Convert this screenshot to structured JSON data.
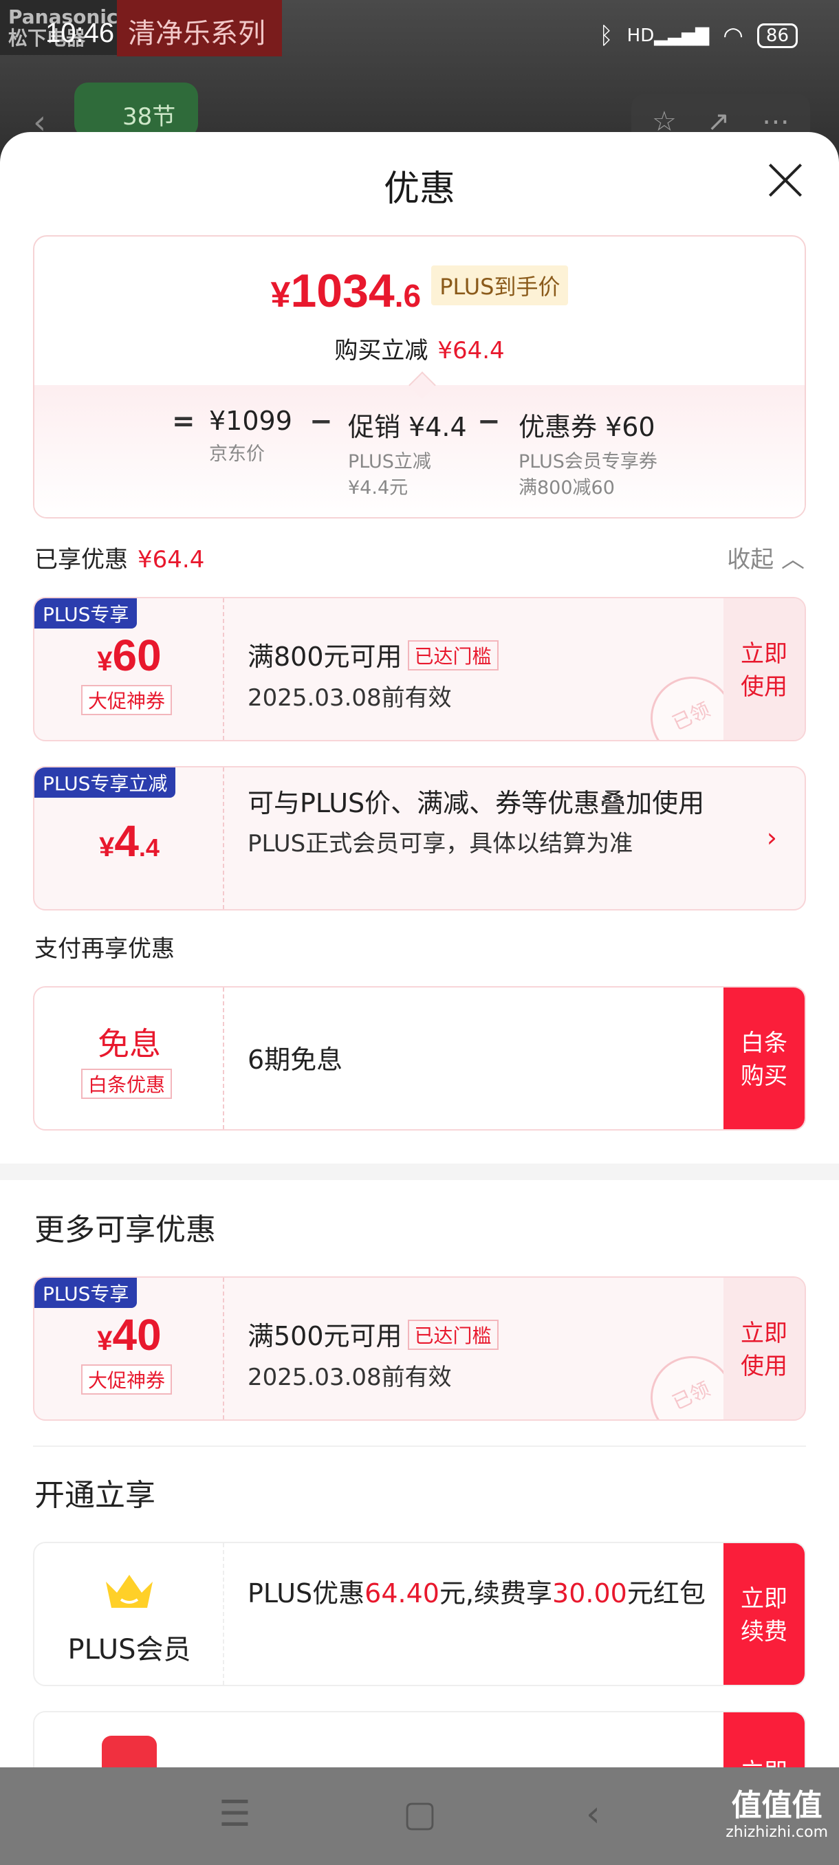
{
  "status": {
    "time": "10:46",
    "battery": "86",
    "net": "HD"
  },
  "background": {
    "brand": "Panasonic 松下电器",
    "series": "清净乐系列",
    "festival": "38节"
  },
  "sheet": {
    "title": "优惠"
  },
  "summary": {
    "price_yen": "¥",
    "price_int": "1034",
    "price_dec": ".6",
    "plus_tag": "PLUS到手价",
    "discount_label": "购买立减",
    "discount_value": "¥64.4",
    "eq": "=",
    "minus": "−",
    "jd_price": "¥1099",
    "jd_label": "京东价",
    "promo_value": "促销 ¥4.4",
    "promo_sub1": "PLUS立减",
    "promo_sub2": "¥4.4元",
    "coupon_value": "优惠券 ¥60",
    "coupon_sub1": "PLUS会员专享券",
    "coupon_sub2": "满800减60"
  },
  "enjoyed": {
    "label": "已享优惠",
    "value": "¥64.4",
    "collapse": "收起 ︿"
  },
  "coupon1": {
    "tag": "PLUS专享",
    "yen": "¥",
    "amount": "60",
    "sublabel": "大促神券",
    "line1": "满800元可用",
    "badge": "已达门槛",
    "line2": "2025.03.08前有效",
    "action": "立即\n使用",
    "stamp": "已领"
  },
  "coupon2": {
    "tag": "PLUS专享立减",
    "yen": "¥",
    "amount": "4",
    "dec": ".4",
    "line1": "可与PLUS价、满减、券等优惠叠加使用",
    "line2": "PLUS正式会员可享，具体以结算为准",
    "arrow": "›"
  },
  "pay": {
    "label": "支付再享优惠",
    "title": "免息",
    "sublabel": "白条优惠",
    "desc": "6期免息",
    "action": "白条\n购买"
  },
  "more": {
    "heading": "更多可享优惠",
    "tag": "PLUS专享",
    "yen": "¥",
    "amount": "40",
    "sublabel": "大促神券",
    "line1": "满500元可用",
    "badge": "已达门槛",
    "line2": "2025.03.08前有效",
    "action": "立即\n使用",
    "stamp": "已领"
  },
  "open": {
    "heading": "开通立享",
    "member": "PLUS会员",
    "text_a": "PLUS优惠",
    "num_a": "64.40",
    "text_b": "元,续费享",
    "num_b": "30.00",
    "text_c": "元红包",
    "action": "立即\n续费",
    "next_action": "立即"
  },
  "watermark": {
    "main": "值值值",
    "site": "zhizhizhi.com"
  },
  "colors": {
    "accent": "#e8182d",
    "plus_blue": "#2b3dae",
    "action_red": "#fa1e3a"
  }
}
